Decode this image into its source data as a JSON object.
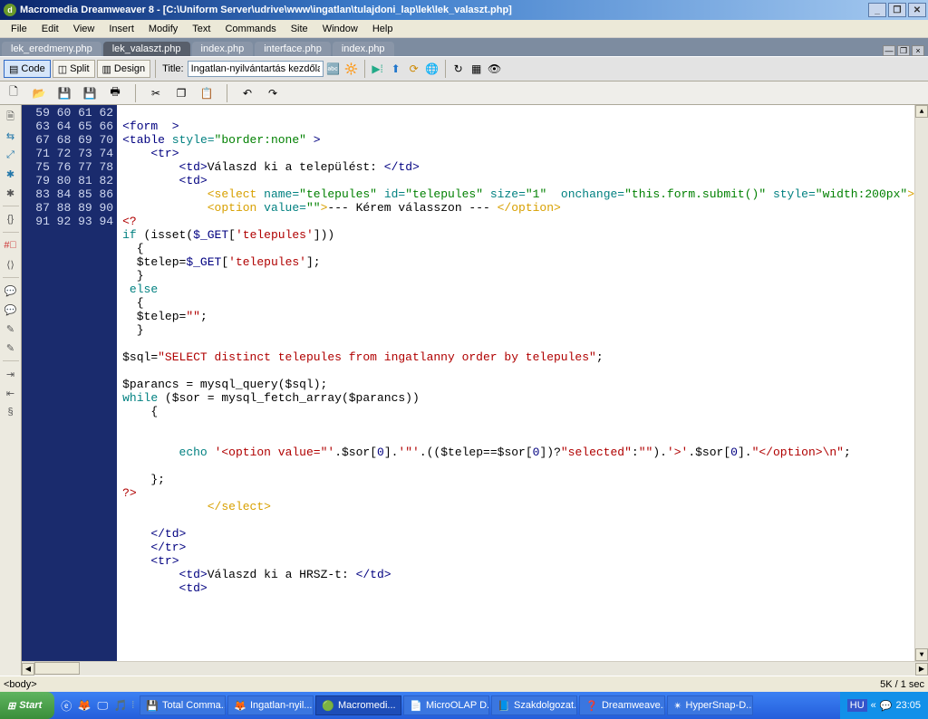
{
  "title": "Macromedia Dreamweaver 8 - [C:\\Uniform Server\\udrive\\www\\ingatlan\\tulajdoni_lap\\lek\\lek_valaszt.php]",
  "menu": [
    "File",
    "Edit",
    "View",
    "Insert",
    "Modify",
    "Text",
    "Commands",
    "Site",
    "Window",
    "Help"
  ],
  "tabs": [
    {
      "label": "lek_eredmeny.php",
      "active": false
    },
    {
      "label": "lek_valaszt.php",
      "active": true
    },
    {
      "label": "index.php",
      "active": false
    },
    {
      "label": "interface.php",
      "active": false
    },
    {
      "label": "index.php",
      "active": false
    }
  ],
  "viewbuttons": {
    "code": "Code",
    "split": "Split",
    "design": "Design"
  },
  "titlelabel": "Title:",
  "doctitle": "Ingatlan-nyilvántartás kezdőla",
  "lines": {
    "start": 59,
    "end": 94
  },
  "code": [
    {
      "n": 59,
      "html": ""
    },
    {
      "n": 60,
      "html": "<span class='t-tag'>&lt;form  &gt;</span>"
    },
    {
      "n": 61,
      "html": "<span class='t-tag'>&lt;table</span> <span class='t-attr'>style=</span><span class='t-val'>\"border:none\"</span> <span class='t-tag'>&gt;</span>"
    },
    {
      "n": 62,
      "html": "    <span class='t-tag'>&lt;tr&gt;</span>"
    },
    {
      "n": 63,
      "html": "        <span class='t-tag'>&lt;td&gt;</span><span class='t-text'>Válaszd ki a települést: </span><span class='t-tag'>&lt;/td&gt;</span>"
    },
    {
      "n": 64,
      "html": "        <span class='t-tag'>&lt;td&gt;</span>"
    },
    {
      "n": 65,
      "html": "            <span class='t-sel'>&lt;select</span> <span class='t-attr'>name=</span><span class='t-val'>\"telepules\"</span> <span class='t-attr'>id=</span><span class='t-val'>\"telepules\"</span> <span class='t-attr'>size=</span><span class='t-val'>\"1\"</span>  <span class='t-attr'>onchange=</span><span class='t-val'>\"this.form.submit()\"</span> <span class='t-attr'>style=</span><span class='t-val'>\"width:200px\"</span><span class='t-sel'>&gt;</span>"
    },
    {
      "n": 66,
      "html": "            <span class='t-sel'>&lt;option</span> <span class='t-attr'>value=</span><span class='t-val'>\"\"</span><span class='t-sel'>&gt;</span><span class='t-text'>--- Kérem válasszon --- </span><span class='t-sel'>&lt;/option&gt;</span>"
    },
    {
      "n": 67,
      "html": "<span class='t-str'>&lt;?</span>"
    },
    {
      "n": 68,
      "html": "<span class='t-attr'>if</span> (isset(<span class='t-tag'>$_GET</span>[<span class='t-str'>'telepules'</span>]))"
    },
    {
      "n": 69,
      "html": "  {"
    },
    {
      "n": 70,
      "html": "  $telep=<span class='t-tag'>$_GET</span>[<span class='t-str'>'telepules'</span>];"
    },
    {
      "n": 71,
      "html": "  }"
    },
    {
      "n": 72,
      "html": " <span class='t-attr'>else</span>"
    },
    {
      "n": 73,
      "html": "  {"
    },
    {
      "n": 74,
      "html": "  $telep=<span class='t-str'>\"\"</span>;"
    },
    {
      "n": 75,
      "html": "  }"
    },
    {
      "n": 76,
      "html": ""
    },
    {
      "n": 77,
      "html": "$sql=<span class='t-str'>\"SELECT distinct telepules from ingatlanny order by telepules\"</span>;"
    },
    {
      "n": 78,
      "html": ""
    },
    {
      "n": 79,
      "html": "$parancs = mysql_query($sql);"
    },
    {
      "n": 80,
      "html": "<span class='t-attr'>while</span> ($sor = mysql_fetch_array($parancs))"
    },
    {
      "n": 81,
      "html": "    {"
    },
    {
      "n": 82,
      "html": ""
    },
    {
      "n": 83,
      "html": ""
    },
    {
      "n": 84,
      "html": "        <span class='t-attr'>echo</span> <span class='t-str'>'&lt;option value=\"'</span>.$sor[<span class='t-tag'>0</span>].<span class='t-str'>'\"'</span>.(($telep==$sor[<span class='t-tag'>0</span>])?<span class='t-str'>\"selected\"</span>:<span class='t-str'>\"\"</span>).<span class='t-str'>'&gt;'</span>.$sor[<span class='t-tag'>0</span>].<span class='t-str'>\"&lt;/option&gt;\\n\"</span>;"
    },
    {
      "n": 85,
      "html": ""
    },
    {
      "n": 86,
      "html": "    };"
    },
    {
      "n": 87,
      "html": "<span class='t-str'>?&gt;</span>"
    },
    {
      "n": 88,
      "html": "            <span class='t-sel'>&lt;/select&gt;</span>"
    },
    {
      "n": 89,
      "html": ""
    },
    {
      "n": 90,
      "html": "    <span class='t-tag'>&lt;/td&gt;</span>"
    },
    {
      "n": 91,
      "html": "    <span class='t-tag'>&lt;/tr&gt;</span>"
    },
    {
      "n": 92,
      "html": "    <span class='t-tag'>&lt;tr&gt;</span>"
    },
    {
      "n": 93,
      "html": "        <span class='t-tag'>&lt;td&gt;</span><span class='t-text'>Válaszd ki a HRSZ-t: </span><span class='t-tag'>&lt;/td&gt;</span>"
    },
    {
      "n": 94,
      "html": "        <span class='t-tag'>&lt;td&gt;</span>"
    }
  ],
  "tagselector": "<body>",
  "status": "5K / 1 sec",
  "start": "Start",
  "taskbuttons": [
    {
      "label": "Total Comma...",
      "icon": "💾"
    },
    {
      "label": "Ingatlan-nyil...",
      "icon": "🦊"
    },
    {
      "label": "Macromedi...",
      "icon": "🟢",
      "active": true
    },
    {
      "label": "MicroOLAP D...",
      "icon": "📄"
    },
    {
      "label": "Szakdolgozat...",
      "icon": "📘"
    },
    {
      "label": "Dreamweave...",
      "icon": "❓"
    },
    {
      "label": "HyperSnap-D...",
      "icon": "✴"
    }
  ],
  "tray": {
    "lang": "HU",
    "clock": "23:05"
  }
}
